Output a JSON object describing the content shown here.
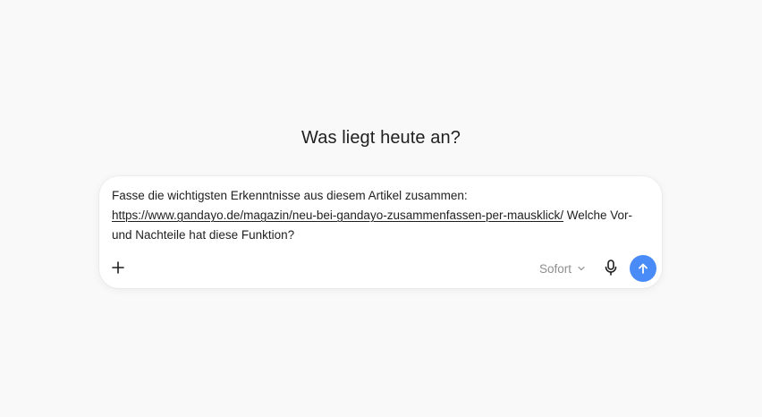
{
  "heading": "Was liegt heute an?",
  "composer": {
    "text_line1": "Fasse die wichtigsten Erkenntnisse aus diesem Artikel zusammen:",
    "link": "https://www.gandayo.de/magazin/neu-bei-gandayo-zusammenfassen-per-mausklick/",
    "text_after_link": " Welche Vor- und Nachteile hat diese Funktion?",
    "model_label": "Sofort",
    "add_icon": "plus-icon",
    "model_icon": "chevron-down-icon",
    "mic_icon": "microphone-icon",
    "send_icon": "arrow-up-icon"
  },
  "colors": {
    "background": "#f9f9f9",
    "send_button": "#4a8cf7",
    "muted_text": "#8e8e8e"
  }
}
